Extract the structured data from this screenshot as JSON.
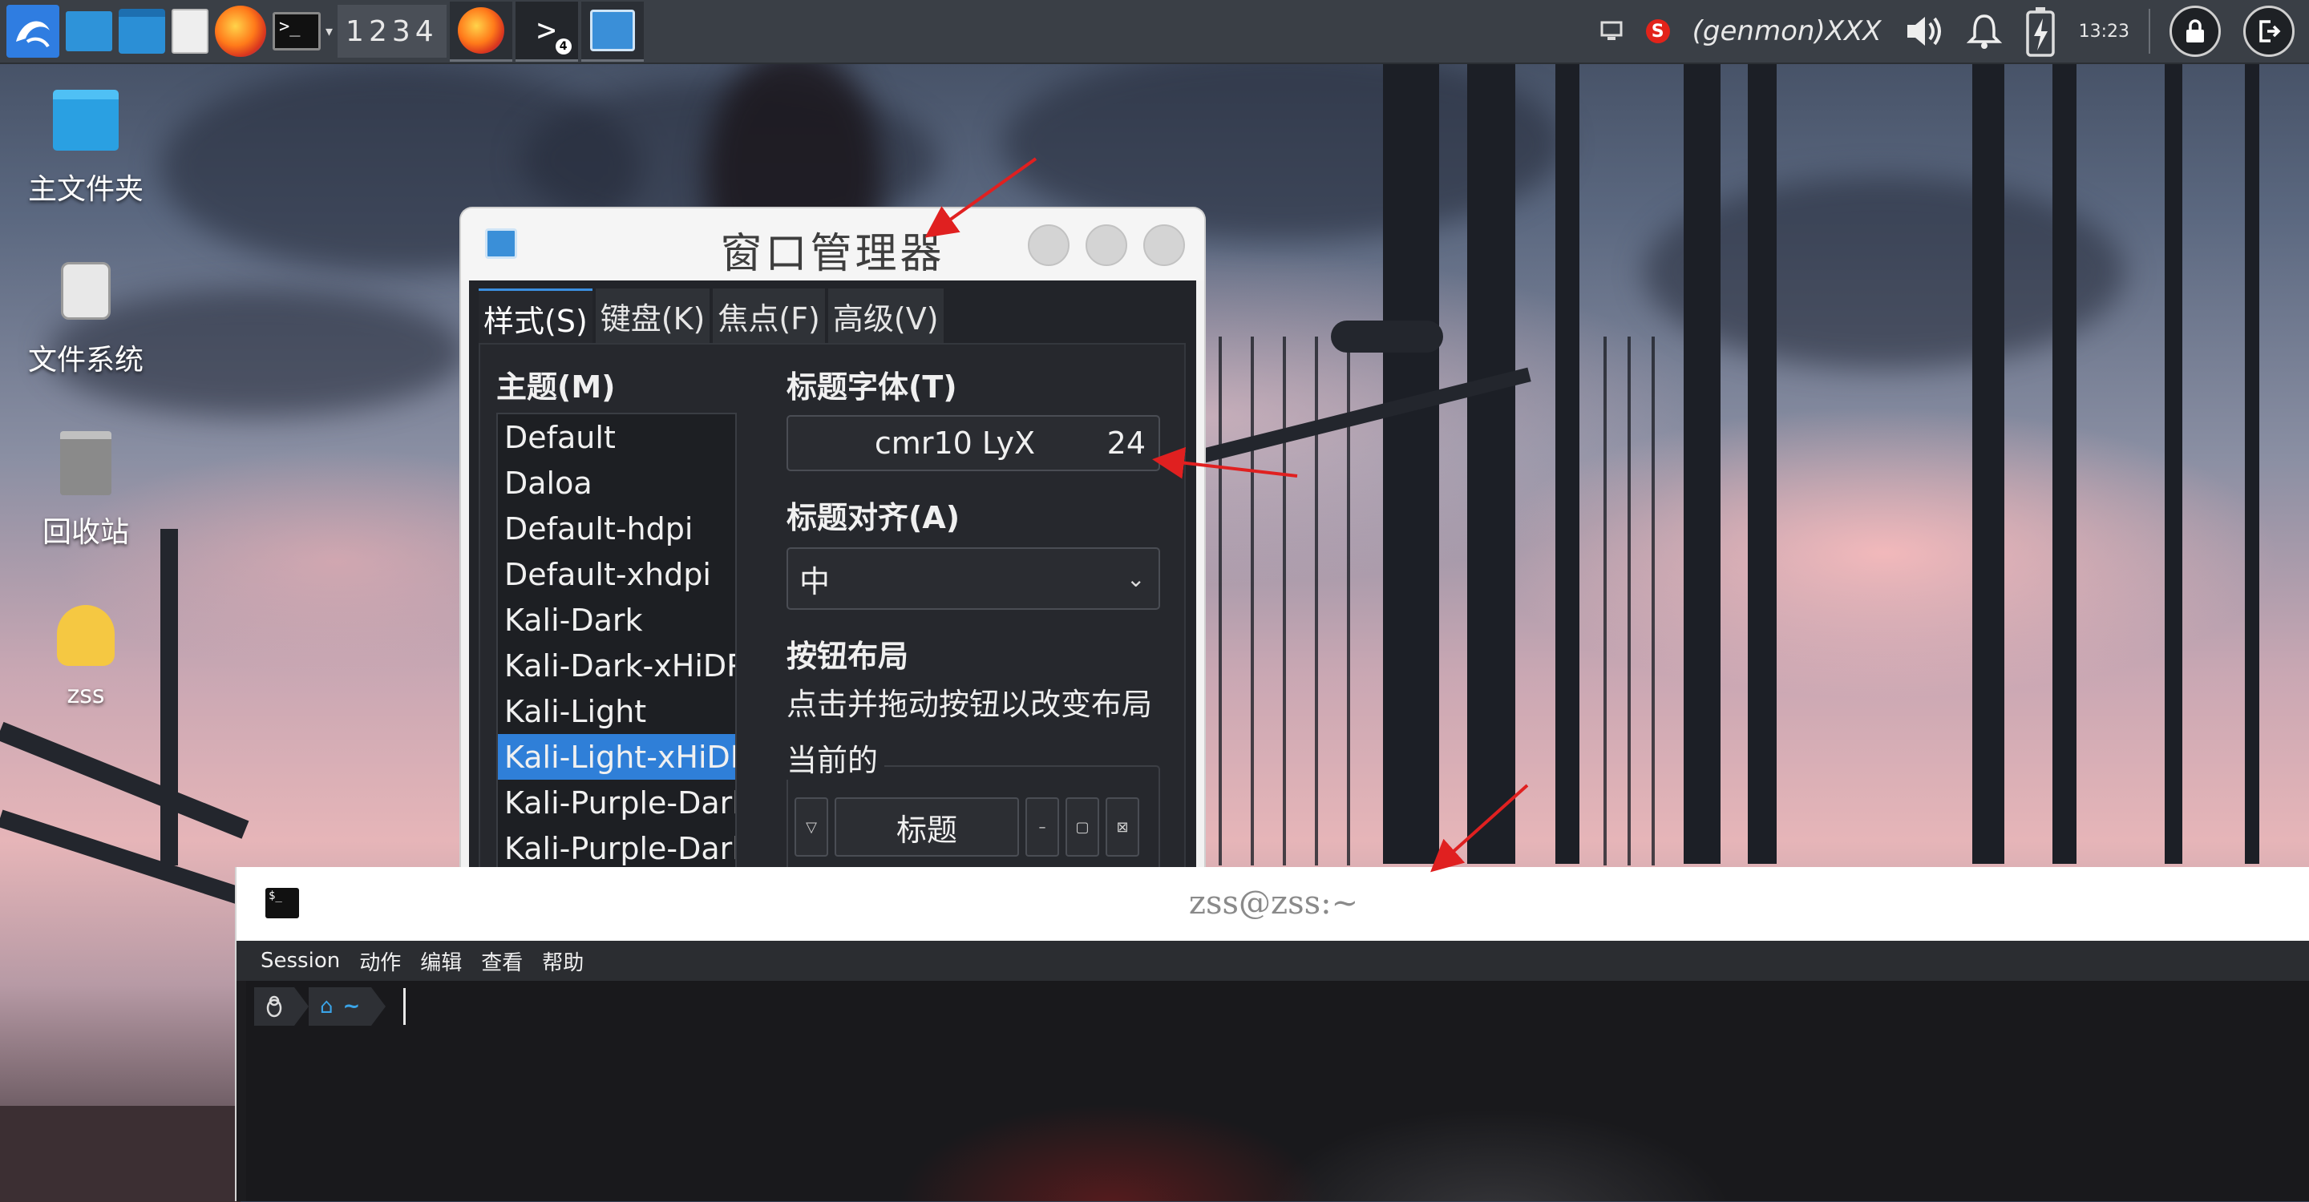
{
  "panel": {
    "workspaces": "1234",
    "genmon": "(genmon)XXX",
    "clock": "13:23",
    "task_badge": "4"
  },
  "desktop": {
    "icons": [
      {
        "label": "主文件夹"
      },
      {
        "label": "文件系统"
      },
      {
        "label": "回收站"
      },
      {
        "label": "zss"
      }
    ]
  },
  "wm_dialog": {
    "title": "窗口管理器",
    "tabs": [
      "样式(S)",
      "键盘(K)",
      "焦点(F)",
      "高级(V)"
    ],
    "theme_label": "主题(M)",
    "themes": [
      "Default",
      "Daloa",
      "Default-hdpi",
      "Default-xhdpi",
      "Kali-Dark",
      "Kali-Dark-xHiDPI",
      "Kali-Light",
      "Kali-Light-xHiDPI",
      "Kali-Purple-Dark",
      "Kali-Purple-Dark-"
    ],
    "selected_theme": "Kali-Light-xHiDPI",
    "title_font_label": "标题字体(T)",
    "title_font_name": "cmr10 LyX",
    "title_font_size": "24",
    "title_align_label": "标题对齐(A)",
    "title_align_value": "中",
    "button_layout_label": "按钮布局",
    "button_layout_hint": "点击并拖动按钮以改变布局",
    "current_label": "当前的",
    "layout_title_button": "标题"
  },
  "terminal": {
    "title": "zss@zss:~",
    "menu": [
      "Session",
      "动作",
      "编辑",
      "查看",
      "帮助"
    ],
    "prompt_user_icon": "linux-penguin-icon",
    "prompt_dir_glyph": "~"
  },
  "colors": {
    "panel_bg": "#3a3f46",
    "selection": "#2f7fd8",
    "annotation_arrow": "#e02020"
  }
}
